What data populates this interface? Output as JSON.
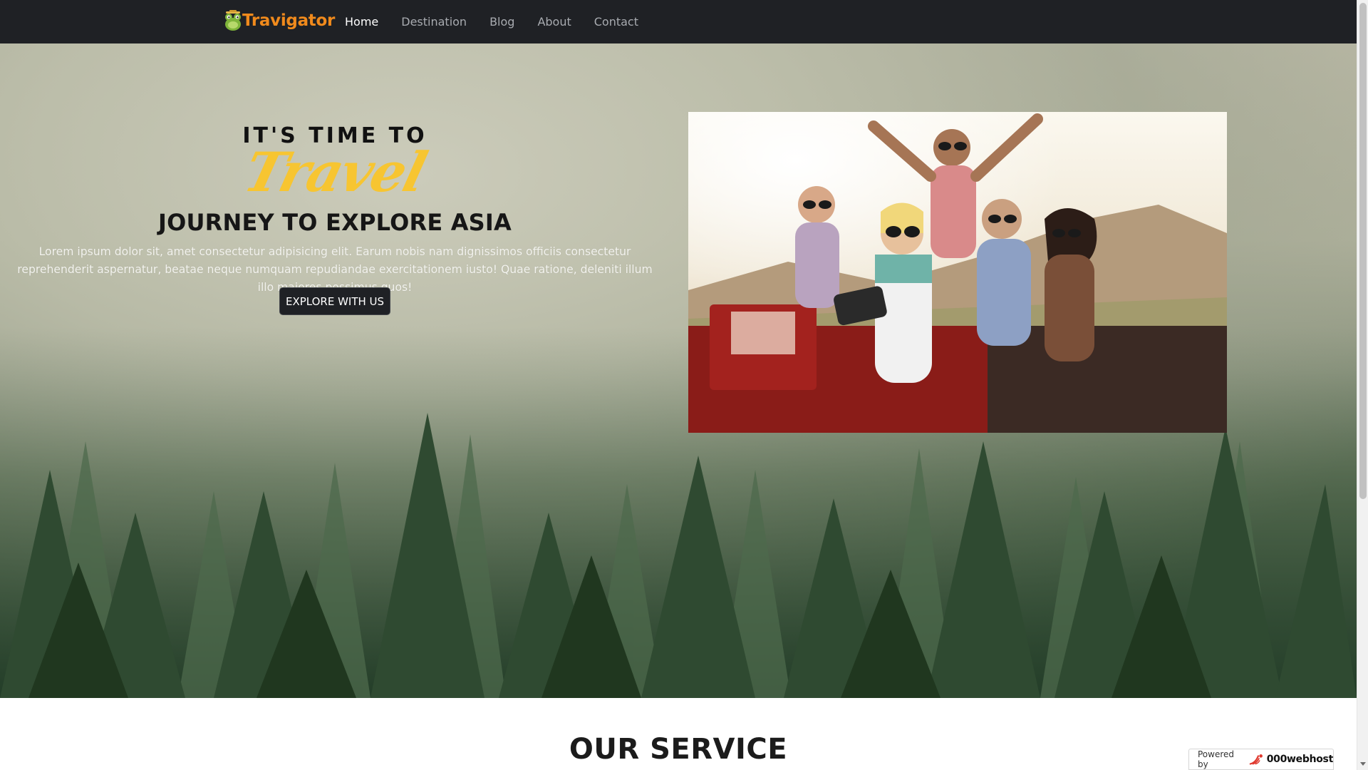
{
  "brand": {
    "name": "Travigator",
    "icon": "frog-logo-icon",
    "color": "#f08a1c"
  },
  "nav": {
    "items": [
      {
        "label": "Home",
        "active": true
      },
      {
        "label": "Destination",
        "active": false
      },
      {
        "label": "Blog",
        "active": false
      },
      {
        "label": "About",
        "active": false
      },
      {
        "label": "Contact",
        "active": false
      }
    ]
  },
  "hero": {
    "tagline_top": "IT'S TIME TO",
    "tagline_script": "Travel",
    "title": "JOURNEY TO EXPLORE ASIA",
    "body": "Lorem ipsum dolor sit, amet consectetur adipisicing elit. Earum nobis nam dignissimos officiis consectetur reprehenderit aspernatur, beatae neque numquam repudiandae exercitationem iusto! Quae ratione, deleniti illum illo maiores possimus quos!",
    "button_label": "EXPLORE WITH US",
    "accent_color": "#f7c531"
  },
  "service": {
    "title": "OUR SERVICE"
  },
  "footer_badge": {
    "label": "Powered by",
    "name": "000webhost",
    "icon": "000webhost-logo-icon"
  }
}
